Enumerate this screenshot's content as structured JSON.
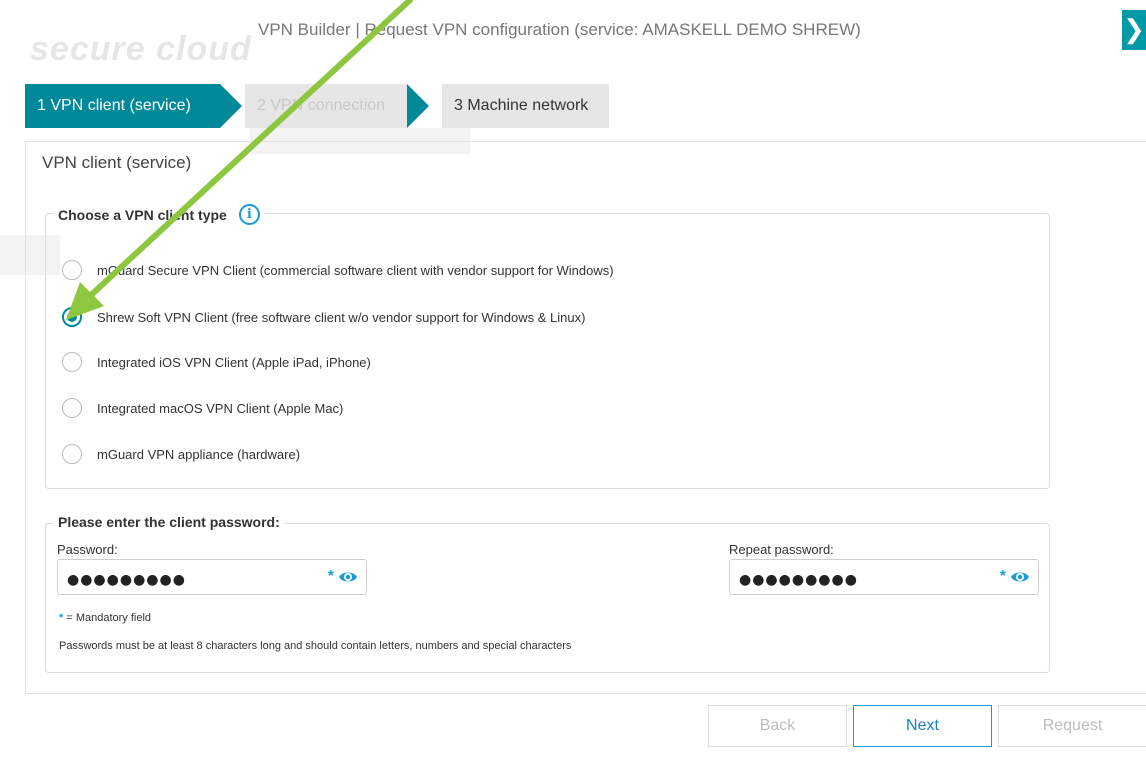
{
  "background": {
    "ghost_text": "secure cloud"
  },
  "dialog": {
    "title": "VPN Builder | Request VPN configuration (service: AMASKELL DEMO SHREW)",
    "close_glyph": "❯"
  },
  "steps": [
    {
      "label": "1  VPN client (service)",
      "state": "active"
    },
    {
      "label": "2  VPN connection",
      "state": "disabled"
    },
    {
      "label": "3  Machine network",
      "state": "inactive"
    }
  ],
  "panel": {
    "title": "VPN client (service)"
  },
  "client_type": {
    "legend": "Choose a VPN client type",
    "info_glyph": "i",
    "options": [
      {
        "label": "mGuard Secure VPN Client (commercial software client with vendor support for Windows)",
        "checked": false
      },
      {
        "label": "Shrew Soft VPN Client (free software client w/o vendor support for Windows & Linux)",
        "checked": true
      },
      {
        "label": "Integrated iOS VPN Client (Apple iPad, iPhone)",
        "checked": false
      },
      {
        "label": "Integrated macOS VPN Client (Apple Mac)",
        "checked": false
      },
      {
        "label": "mGuard VPN appliance (hardware)",
        "checked": false
      }
    ]
  },
  "password": {
    "legend": "Please enter the client password:",
    "password_label": "Password:",
    "password_value": "●●●●●●●●●",
    "repeat_label": "Repeat password:",
    "repeat_value": "●●●●●●●●●",
    "required_marker": "*",
    "mandatory_star": "*",
    "mandatory_text": " = Mandatory field",
    "hint": "Passwords must be at least 8 characters long and should contain letters, numbers and special characters"
  },
  "buttons": {
    "back": "Back",
    "next": "Next",
    "request": "Request"
  },
  "colors": {
    "accent": "#008a99",
    "info_blue": "#1a9bd7",
    "annotation_arrow": "#8dc63f"
  }
}
